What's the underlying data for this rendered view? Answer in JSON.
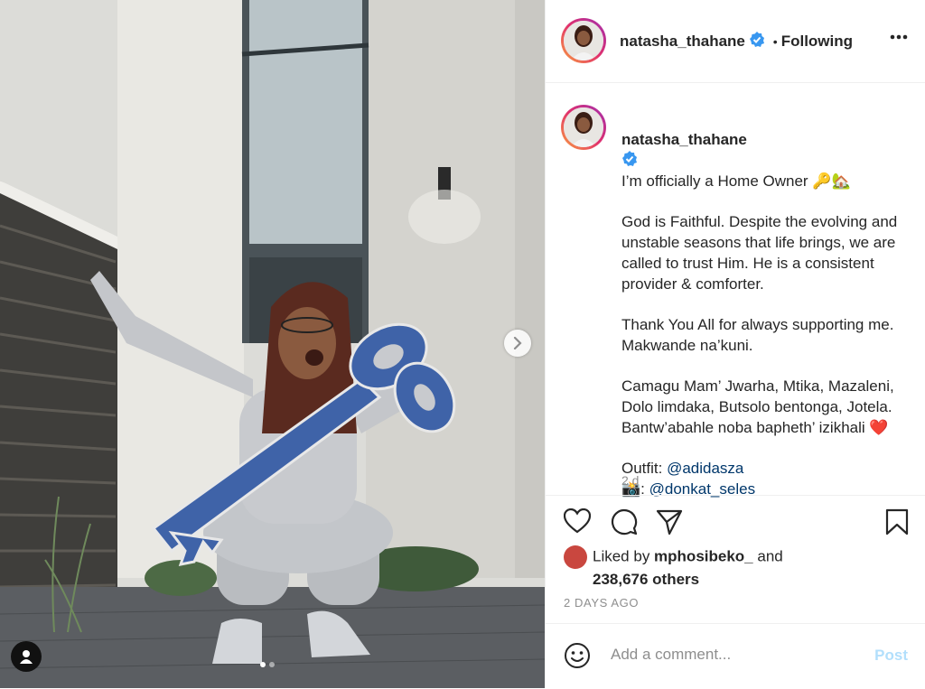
{
  "post": {
    "username": "natasha_thahane",
    "follow_separator": "•",
    "follow_status": "Following",
    "caption_title": "I’m officially a Home Owner 🔑🏡",
    "caption_paragraphs": [
      "God is Faithful. Despite the evolving and unstable seasons that life brings, we are called to trust Him. He is a consistent provider & comforter.",
      "Thank You All for always supporting me. Makwande na’kuni.",
      "Camagu Mam’ Jwarha, Mtika, Mazaleni, Dolo limdaka, Butsolo bentonga, Jotela. Bantw’abahle noba bapheth’ izikhali ❤️"
    ],
    "outfit_label": "Outfit: ",
    "outfit_mention": "@adidasza",
    "photo_label": "📸: ",
    "photo_mention": "@donkat_seles",
    "age_short": "2 d",
    "liked_by_prefix": "Liked by ",
    "liked_by_user": "mphosibeko_",
    "liked_by_and": " and",
    "likes_count": "238,676 others",
    "date": "2 DAYS AGO"
  },
  "comment": {
    "placeholder": "Add a comment...",
    "post_label": "Post"
  },
  "carousel": {
    "total": 2,
    "current": 1
  },
  "icons": [
    "verified-badge-icon",
    "more-options-icon",
    "heart-icon",
    "comment-icon",
    "share-icon",
    "bookmark-icon",
    "emoji-icon",
    "chevron-right-icon",
    "user-tag-icon"
  ],
  "colors": {
    "accent": "#0095f6",
    "mention": "#00376b",
    "muted": "#8e8e8e",
    "post_disabled": "#b2dffc"
  }
}
